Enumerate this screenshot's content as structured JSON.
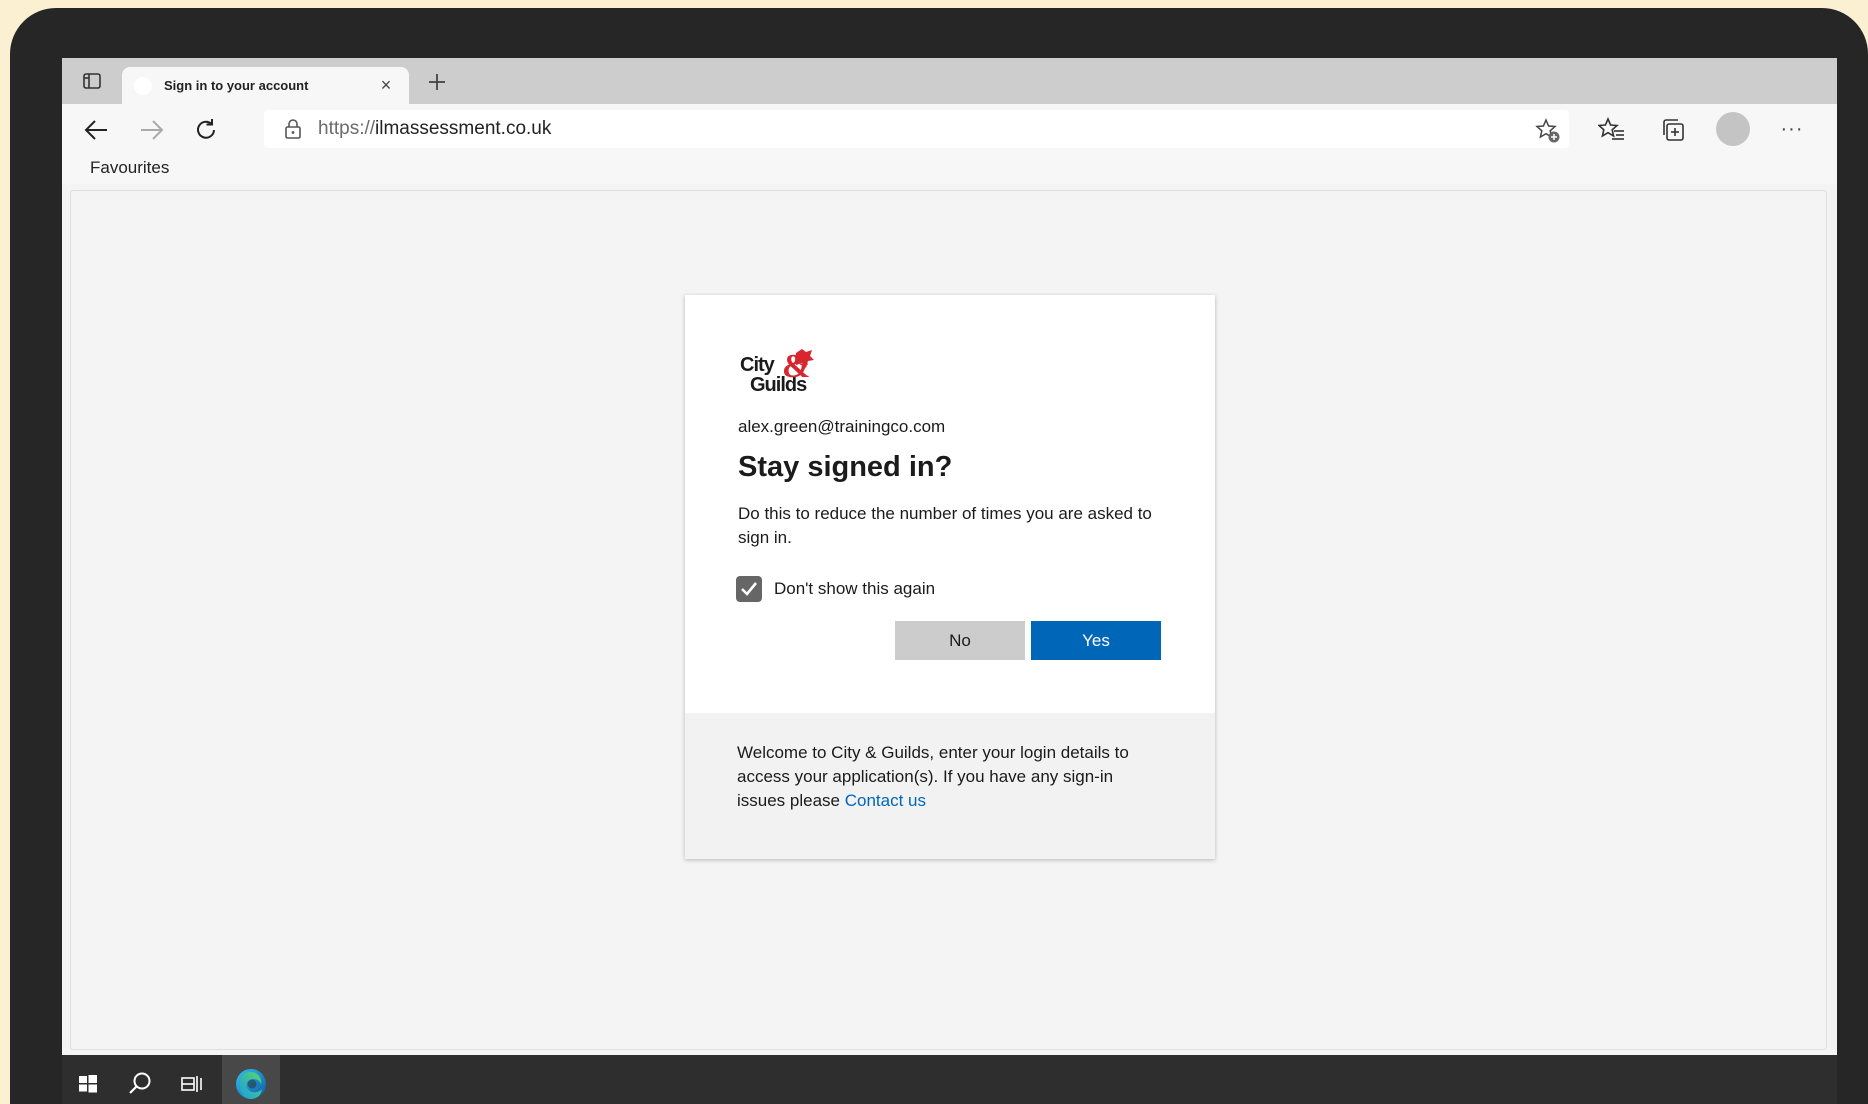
{
  "browser": {
    "tab_title": "Sign in to your account",
    "tab_close": "×",
    "url_protocol": "https://",
    "url_host": "ilmassessment.co.uk",
    "favourites_label": "Favourites",
    "menu_label": "···"
  },
  "dialog": {
    "logo_text_top": "City",
    "logo_text_bottom": "Guilds",
    "logo_ampersand": "&",
    "email": "alex.green@trainingco.com",
    "heading": "Stay signed in?",
    "description": "Do this to reduce the number of times you are asked to sign in.",
    "checkbox_label": "Don't show this again",
    "checkbox_checked": true,
    "no_label": "No",
    "yes_label": "Yes",
    "footer_text": "Welcome to City & Guilds, enter your login details to access your application(s). If you have any sign-in issues please ",
    "contact_link": "Contact us"
  },
  "colors": {
    "background": "#fbf1d2",
    "primary_button": "#0067b8",
    "link": "#0067b8",
    "logo_red": "#d8262e"
  },
  "icons": {
    "tab_actions": "tab-actions-icon",
    "back": "back-arrow-icon",
    "forward": "forward-arrow-icon",
    "refresh": "refresh-icon",
    "lock": "lock-icon",
    "add_favourite": "add-favourite-icon",
    "favourites": "favourites-icon",
    "collections": "collections-icon",
    "windows": "windows-start-icon",
    "search": "search-icon",
    "task_view": "task-view-icon",
    "edge": "edge-browser-icon"
  }
}
